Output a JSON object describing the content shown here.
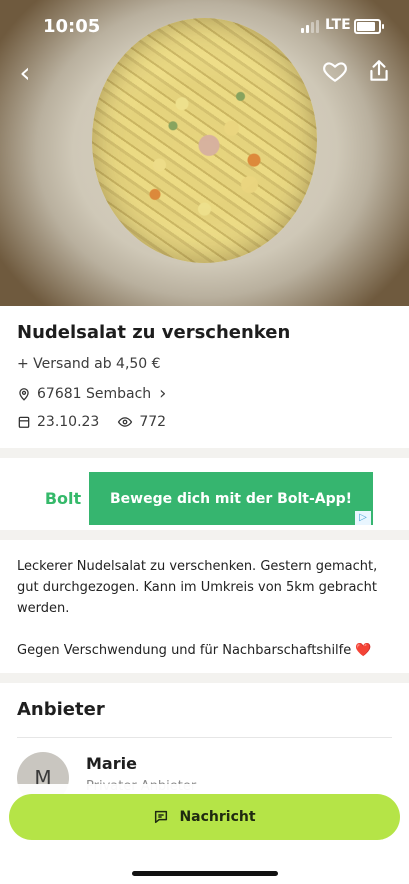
{
  "status_bar": {
    "time": "10:05",
    "network": "LTE"
  },
  "listing": {
    "title": "Nudelsalat zu verschenken",
    "shipping": "+ Versand ab 4,50 €",
    "location": "67681 Sembach",
    "date": "23.10.23",
    "views": "772",
    "description": "Leckerer Nudelsalat zu verschenken. Gestern gemacht, gut durchgezogen. Kann im Umkreis von 5km gebracht werden.\n\nGegen Verschwendung und für Nachbarschaftshilfe ❤️"
  },
  "ad": {
    "brand": "Bolt",
    "text": "Bewege dich mit der Bolt-App!",
    "choice": "▷"
  },
  "seller": {
    "section_title": "Anbieter",
    "avatar_initial": "M",
    "name": "Marie",
    "type": "Privater Anbieter"
  },
  "actions": {
    "message_label": "Nachricht"
  },
  "icons": {
    "back": "chevron-left-icon",
    "favorite": "heart-icon",
    "share": "share-icon",
    "location": "location-pin-icon",
    "date": "calendar-icon",
    "views": "eye-icon",
    "message": "message-icon"
  },
  "colors": {
    "accent": "#b5e447",
    "ad_green": "#36b56f",
    "background": "#f3f2ef"
  }
}
